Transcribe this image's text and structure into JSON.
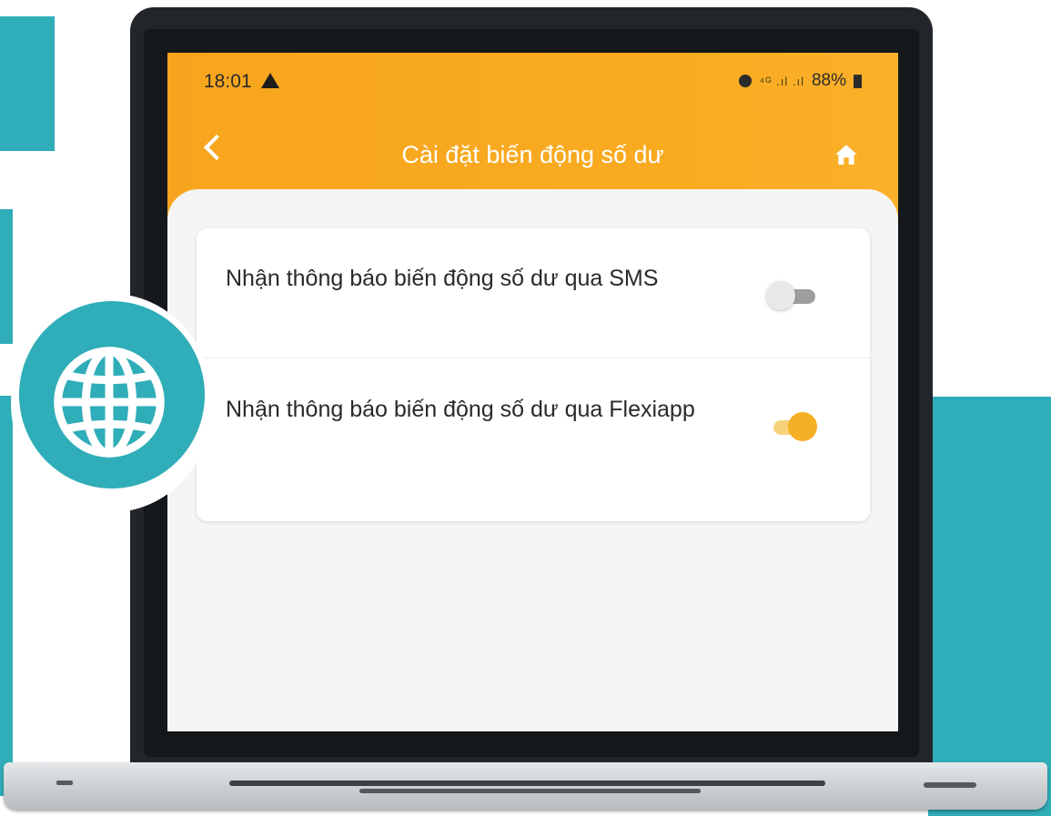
{
  "status_bar": {
    "time": "18:01",
    "signal": "⁴ᴳ .ıl .ıl",
    "battery": "88%"
  },
  "header": {
    "title": "Cài đặt biến động số dư",
    "back_icon": "chevron-left-icon",
    "home_icon": "home-icon"
  },
  "settings": [
    {
      "label": "Nhận thông báo biến động số dư qua SMS",
      "enabled": false
    },
    {
      "label": "Nhận thông báo biến động số dư qua Flexiapp",
      "enabled": true
    }
  ],
  "colors": {
    "accent": "#f9ab20",
    "teal": "#2fadb8",
    "toggle_on": "#f6b026"
  },
  "decor_icon": "globe-icon"
}
